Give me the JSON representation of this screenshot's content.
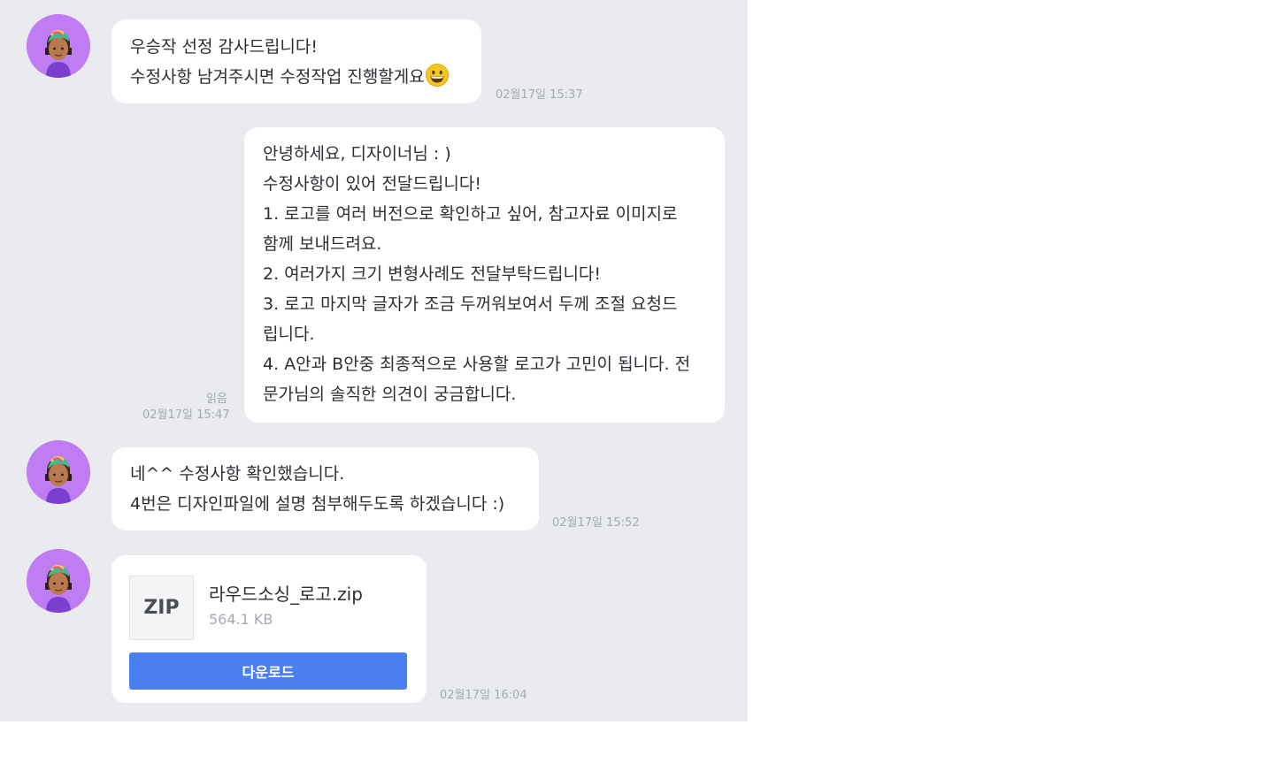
{
  "messages": [
    {
      "sender": "designer",
      "lines": [
        "우승작 선정 감사드립니다!",
        "수정사항 남겨주시면 수정작업 진행할게요"
      ],
      "emoji": "grinning-face-emoji",
      "time": "02월17일 15:37"
    },
    {
      "sender": "me",
      "lines": [
        "안녕하세요, 디자이너님 : )",
        "수정사항이 있어 전달드립니다!",
        "1. 로고를 여러 버전으로 확인하고 싶어, 참고자료 이미지로",
        "함께 보내드려요.",
        "2. 여러가지 크기 변형사례도 전달부탁드립니다!",
        "3. 로고 마지막 글자가 조금 두꺼워보여서 두께 조절 요청드",
        "립니다.",
        "4. A안과 B안중 최종적으로 사용할 로고가 고민이 됩니다. 전",
        "문가님의 솔직한 의견이 궁금합니다."
      ],
      "read_label": "읽음",
      "time": "02월17일 15:47"
    },
    {
      "sender": "designer",
      "lines": [
        "네^^ 수정사항 확인했습니다.",
        "4번은 디자인파일에 설명 첨부해두도록 하겠습니다 :)"
      ],
      "time": "02월17일 15:52"
    },
    {
      "sender": "designer",
      "file": {
        "type_label": "ZIP",
        "name": "라우드소싱_로고.zip",
        "size": "564.1 KB",
        "download_label": "다운로드"
      },
      "time": "02월17일 16:04"
    }
  ],
  "colors": {
    "chat_background": "#e9ebef",
    "bubble": "#ffffff",
    "accent": "#4a7ff0",
    "avatar": "#c07cf2",
    "timestamp": "#a4a8b1"
  }
}
